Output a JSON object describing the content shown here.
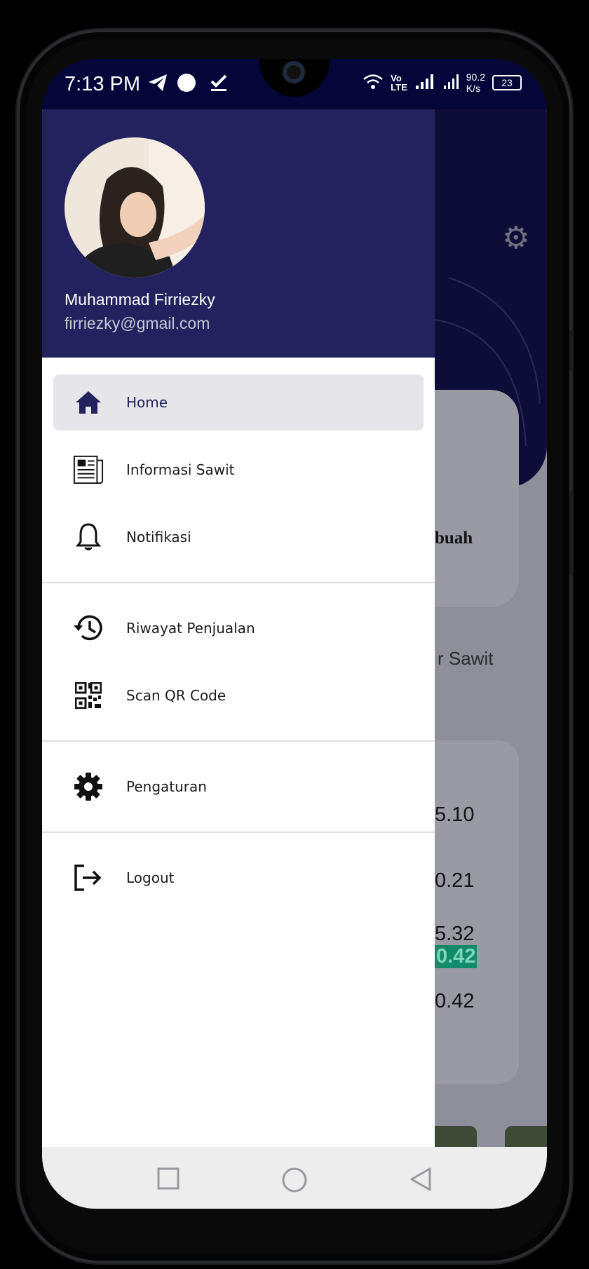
{
  "status_bar": {
    "time": "7:13 PM",
    "net_speed_value": "90.2",
    "net_speed_unit": "K/s",
    "volte_top": "Vo",
    "volte_bottom": "LTE",
    "battery": "23"
  },
  "drawer": {
    "user_name": "Muhammad Firriezky",
    "user_email": "firriezky@gmail.com",
    "menu_items": [
      {
        "label": "Home",
        "icon": "home-icon"
      },
      {
        "label": "Informasi Sawit",
        "icon": "newspaper-icon"
      },
      {
        "label": "Notifikasi",
        "icon": "bell-icon"
      },
      {
        "label": "Riwayat Penjualan",
        "icon": "history-icon"
      },
      {
        "label": "Scan QR Code",
        "icon": "qr-code-icon"
      },
      {
        "label": "Pengaturan",
        "icon": "gear-icon"
      },
      {
        "label": "Logout",
        "icon": "logout-icon"
      }
    ]
  },
  "background_app": {
    "card_title_fragment": "buah",
    "section_title_fragment": "r Sawit",
    "values": [
      "5.10",
      "0.21",
      "5.32",
      "0.42",
      "0.42"
    ]
  },
  "nav_bar": {
    "buttons": [
      "recents-icon",
      "home-circle-icon",
      "back-icon"
    ]
  },
  "colors": {
    "header": "#23225f",
    "status_bar": "#04063a",
    "active_item_bg": "#e5e5ea",
    "highlight": "#158a6a"
  }
}
